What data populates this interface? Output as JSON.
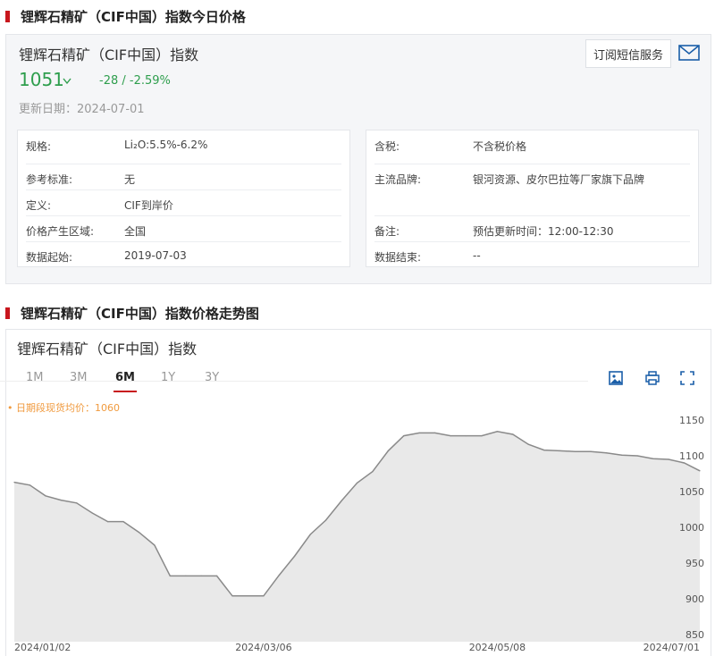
{
  "section1": {
    "title": "锂辉石精矿（CIF中国）指数今日价格"
  },
  "card": {
    "name": "锂辉石精矿（CIF中国）指数",
    "price": "1051",
    "change": "-28  /  -2.59%",
    "updated": "更新日期：2024-07-01",
    "subscribe_label": "订阅短信服务"
  },
  "info_left": [
    {
      "k": "规格:",
      "v": "Li₂O:5.5%-6.2%"
    },
    {
      "k": "参考标准:",
      "v": "无"
    },
    {
      "k": "定义:",
      "v": "CIF到岸价"
    },
    {
      "k": "价格产生区域:",
      "v": "全国"
    },
    {
      "k": "数据起始:",
      "v": "2019-07-03"
    }
  ],
  "info_right": [
    {
      "k": "含税:",
      "v": "不含税价格"
    },
    {
      "k": "主流品牌:",
      "v": "银河资源、皮尔巴拉等厂家旗下品牌"
    },
    {
      "k": "备注:",
      "v": "预估更新时间：12:00-12:30"
    },
    {
      "k": "数据结束:",
      "v": "--"
    }
  ],
  "section2": {
    "title": "锂辉石精矿（CIF中国）指数价格走势图"
  },
  "chart_box": {
    "name": "锂辉石精矿（CIF中国）指数",
    "tabs": [
      "1M",
      "3M",
      "6M",
      "1Y",
      "3Y"
    ],
    "active_tab": "6M",
    "avg_label": "• 日期段现货均价：1060"
  },
  "colors": {
    "accent": "#c8161d",
    "down": "#2e9e4d",
    "avg": "#f09a3e",
    "line": "#8a8a8a",
    "area": "#e9e9e9"
  },
  "chart_data": {
    "type": "area",
    "x": [
      "2024/01/02",
      "2024/01/05",
      "2024/01/08",
      "2024/01/11",
      "2024/01/16",
      "2024/01/19",
      "2024/01/24",
      "2024/01/29",
      "2024/02/01",
      "2024/02/06",
      "2024/02/09",
      "2024/02/14",
      "2024/02/19",
      "2024/02/22",
      "2024/02/27",
      "2024/03/01",
      "2024/03/06",
      "2024/03/11",
      "2024/03/14",
      "2024/03/19",
      "2024/03/22",
      "2024/03/26",
      "2024/03/29",
      "2024/04/03",
      "2024/04/08",
      "2024/04/11",
      "2024/04/16",
      "2024/04/19",
      "2024/04/24",
      "2024/04/29",
      "2024/05/03",
      "2024/05/08",
      "2024/05/13",
      "2024/05/16",
      "2024/05/21",
      "2024/05/24",
      "2024/05/29",
      "2024/06/03",
      "2024/06/06",
      "2024/06/11",
      "2024/06/14",
      "2024/06/19",
      "2024/06/24",
      "2024/06/27",
      "2024/07/01"
    ],
    "values": [
      1063,
      1059,
      1044,
      1038,
      1034,
      1020,
      1008,
      1008,
      993,
      975,
      932,
      932,
      932,
      932,
      904,
      904,
      904,
      933,
      960,
      990,
      1010,
      1037,
      1062,
      1078,
      1107,
      1128,
      1132,
      1132,
      1128,
      1128,
      1128,
      1134,
      1130,
      1116,
      1108,
      1107,
      1106,
      1106,
      1104,
      1101,
      1100,
      1096,
      1095,
      1090,
      1079
    ],
    "x_ticks": [
      "2024/01/02",
      "2024/03/06",
      "2024/05/08",
      "2024/07/01"
    ],
    "y_ticks": [
      850,
      900,
      950,
      1000,
      1050,
      1100,
      1150
    ],
    "ylim": [
      840,
      1160
    ],
    "average": 1060
  }
}
